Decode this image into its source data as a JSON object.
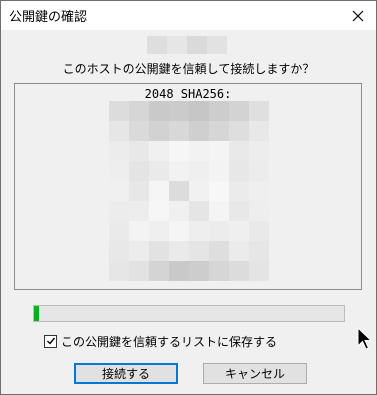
{
  "window": {
    "title": "公開鍵の確認",
    "close_icon": "close-icon"
  },
  "dialog": {
    "question": "このホストの公開鍵を信頼して接続しますか？",
    "fingerprint_label": "2048 SHA256:",
    "progress_percent": 1,
    "save_key_checkbox": {
      "label": "この公開鍵を信頼するリストに保存する",
      "checked": true
    },
    "buttons": {
      "connect": "接続する",
      "cancel": "キャンセル"
    }
  },
  "colors": {
    "progress_fill": "#06b025",
    "default_button_border": "#0078d7"
  }
}
